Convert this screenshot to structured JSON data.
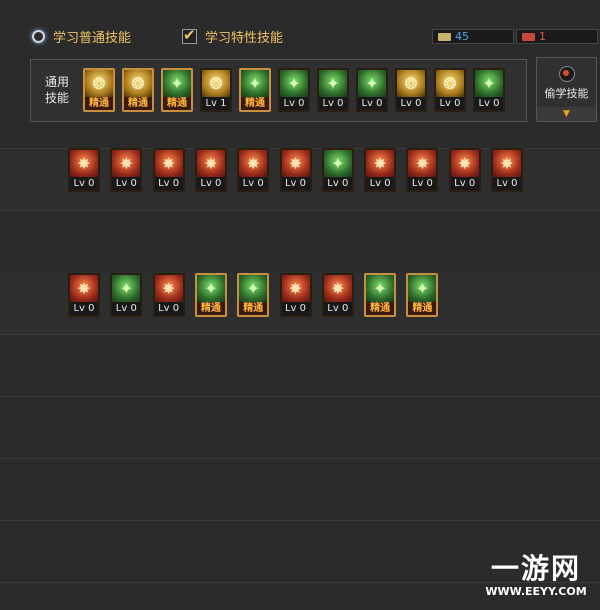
{
  "header": {
    "option_normal": "学习普通技能",
    "option_special": "学习特性技能",
    "counters": [
      {
        "value": "45",
        "color": "#49a9e8"
      },
      {
        "value": "1",
        "color": "#e05a3a"
      }
    ]
  },
  "common_panel": {
    "label": "通用技能",
    "skills": [
      {
        "caption": "精通",
        "theme": "gold",
        "icon": "runner-icon"
      },
      {
        "caption": "精通",
        "theme": "gold",
        "icon": "crouch-icon"
      },
      {
        "caption": "精通",
        "theme": "green",
        "icon": "dash-icon"
      },
      {
        "caption": "Lv 1",
        "theme": "gold",
        "icon": "wings-icon"
      },
      {
        "caption": "精通",
        "theme": "green",
        "icon": "target-icon"
      },
      {
        "caption": "Lv 0",
        "theme": "green",
        "icon": "radar-icon"
      },
      {
        "caption": "Lv 0",
        "theme": "green",
        "icon": "fighter-icon"
      },
      {
        "caption": "Lv 0",
        "theme": "green",
        "icon": "mushroom-icon"
      },
      {
        "caption": "Lv 0",
        "theme": "gold",
        "icon": "spiral-icon"
      },
      {
        "caption": "Lv 0",
        "theme": "gold",
        "icon": "aura-icon"
      },
      {
        "caption": "Lv 0",
        "theme": "green",
        "icon": "scroll-icon"
      }
    ]
  },
  "steal_panel": {
    "label": "偷学技能"
  },
  "row1": [
    {
      "caption": "Lv 0",
      "theme": "red"
    },
    {
      "caption": "Lv 0",
      "theme": "red"
    },
    {
      "caption": "Lv 0",
      "theme": "red"
    },
    {
      "caption": "Lv 0",
      "theme": "red"
    },
    {
      "caption": "Lv 0",
      "theme": "red"
    },
    {
      "caption": "Lv 0",
      "theme": "red"
    },
    {
      "caption": "Lv 0",
      "theme": "green"
    },
    {
      "caption": "Lv 0",
      "theme": "red"
    },
    {
      "caption": "Lv 0",
      "theme": "red"
    },
    {
      "caption": "Lv 0",
      "theme": "red"
    },
    {
      "caption": "Lv 0",
      "theme": "red"
    }
  ],
  "row2": [
    {
      "caption": "Lv 0",
      "theme": "red"
    },
    {
      "caption": "Lv 0",
      "theme": "green"
    },
    {
      "caption": "Lv 0",
      "theme": "red"
    },
    {
      "caption": "精通",
      "theme": "green"
    },
    {
      "caption": "精通",
      "theme": "green"
    },
    {
      "caption": "Lv 0",
      "theme": "red"
    },
    {
      "caption": "Lv 0",
      "theme": "red"
    },
    {
      "caption": "精通",
      "theme": "green"
    },
    {
      "caption": "精通",
      "theme": "green"
    }
  ],
  "watermark": {
    "title": "一游网",
    "url": "WWW.EEYY.COM"
  }
}
